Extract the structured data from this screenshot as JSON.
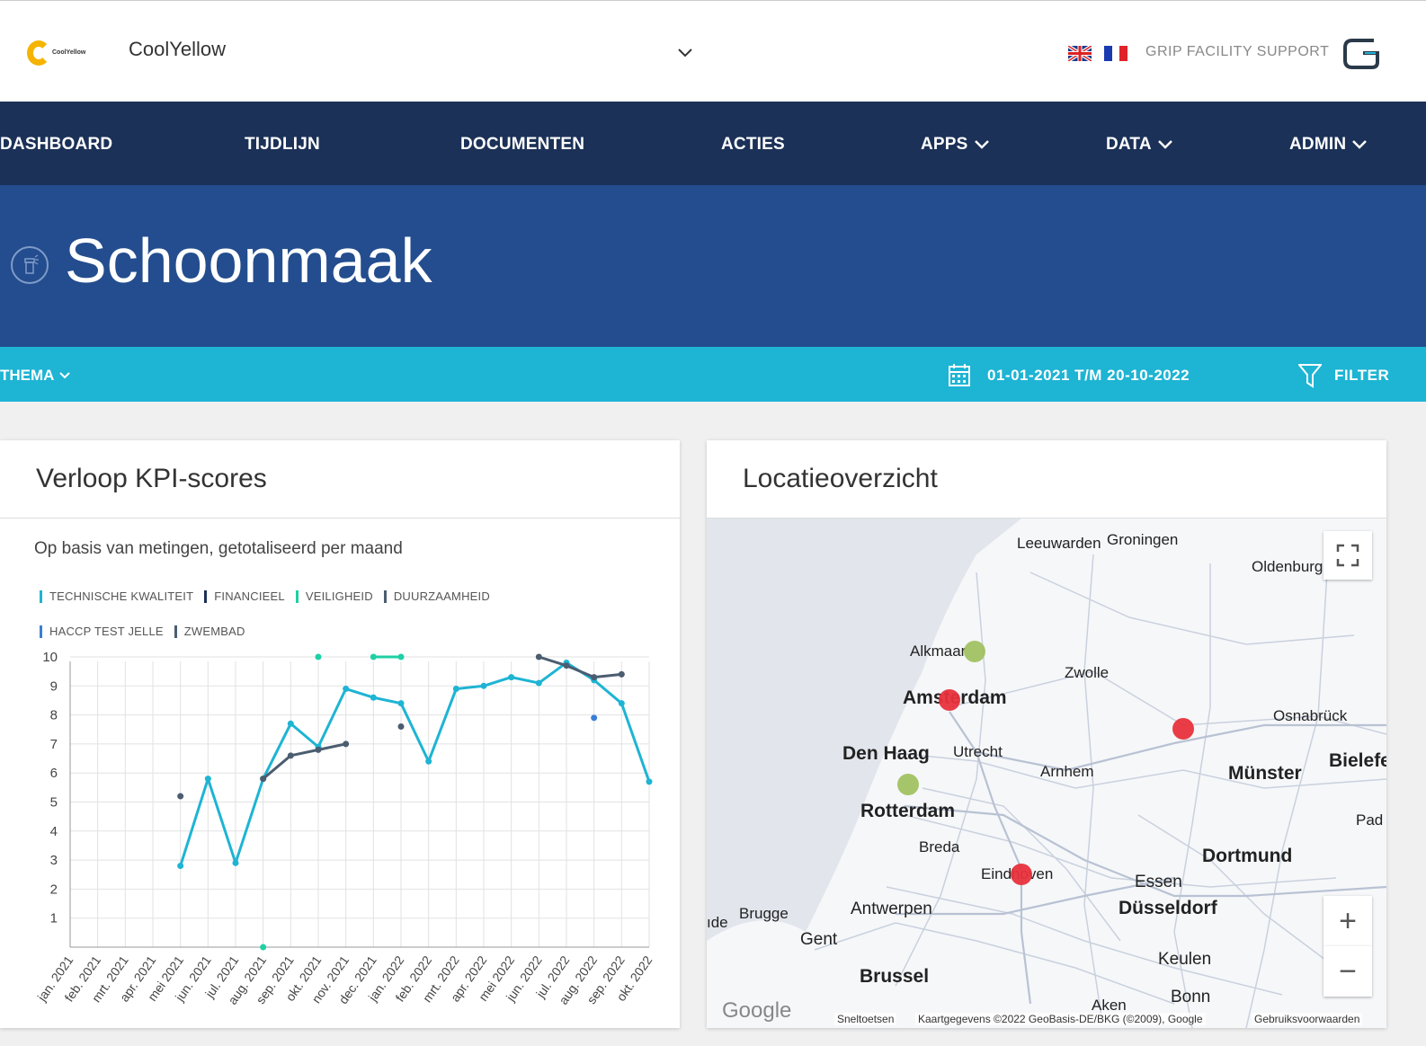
{
  "header": {
    "client_name": "CoolYellow",
    "logo_text": "CoolYellow",
    "support_label": "GRIP FACILITY SUPPORT",
    "flags": [
      "UK flag",
      "French flag"
    ]
  },
  "nav": {
    "items": [
      {
        "label": "DASHBOARD",
        "dropdown": false
      },
      {
        "label": "TIJDLIJN",
        "dropdown": false
      },
      {
        "label": "DOCUMENTEN",
        "dropdown": false
      },
      {
        "label": "ACTIES",
        "dropdown": false
      },
      {
        "label": "APPS",
        "dropdown": true
      },
      {
        "label": "DATA",
        "dropdown": true
      },
      {
        "label": "ADMIN",
        "dropdown": true
      }
    ]
  },
  "hero": {
    "title": "Schoonmaak",
    "icon": "cleaning-spray-icon"
  },
  "filterbar": {
    "thema_label": "THEMA",
    "date_range": "01-01-2021 T/M 20-10-2022",
    "filter_label": "FILTER"
  },
  "kpi_card": {
    "title": "Verloop KPI-scores",
    "subtitle": "Op basis van metingen, getotaliseerd per maand"
  },
  "map_card": {
    "title": "Locatieoverzicht",
    "cities": [
      {
        "name": "Leeuwarden"
      },
      {
        "name": "Groningen"
      },
      {
        "name": "Oldenburg"
      },
      {
        "name": "Alkmaar"
      },
      {
        "name": "Zwolle"
      },
      {
        "name": "Amsterdam"
      },
      {
        "name": "Osnabrück"
      },
      {
        "name": "Den Haag"
      },
      {
        "name": "Utrecht"
      },
      {
        "name": "Bielefe"
      },
      {
        "name": "Arnhem"
      },
      {
        "name": "Münster"
      },
      {
        "name": "Rotterdam"
      },
      {
        "name": "Pad"
      },
      {
        "name": "Breda"
      },
      {
        "name": "Dortmund"
      },
      {
        "name": "Eindhoven"
      },
      {
        "name": "Essen"
      },
      {
        "name": "Brugge"
      },
      {
        "name": "Antwerpen"
      },
      {
        "name": "Düsseldorf"
      },
      {
        "name": "Gent"
      },
      {
        "name": "Keulen"
      },
      {
        "name": "Brussel"
      },
      {
        "name": "Bonn"
      },
      {
        "name": "Aken"
      },
      {
        "name": "Br"
      },
      {
        "name": "ıde"
      }
    ],
    "markers": [
      {
        "color": "#9dbf5a",
        "status": "green"
      },
      {
        "color": "#e8323c",
        "status": "red"
      },
      {
        "color": "#e8323c",
        "status": "red"
      },
      {
        "color": "#9dbf5a",
        "status": "green"
      },
      {
        "color": "#e8323c",
        "status": "red"
      }
    ],
    "footer": {
      "google": "Google",
      "shortcuts": "Sneltoetsen",
      "mapdata": "Kaartgegevens ©2022 GeoBasis-DE/BKG (©2009), Google",
      "terms": "Gebruiksvoorwaarden"
    },
    "zoom_in": "+",
    "zoom_out": "−"
  },
  "colors": {
    "nav_bg": "#1b3157",
    "hero_bg": "#234d8e",
    "filter_bg": "#1eb4d4",
    "series_teal": "#1eb4d4",
    "series_green": "#1fd0a4",
    "series_dark": "#4b5d70",
    "marker_red": "#e8323c",
    "marker_green": "#9dbf5a"
  },
  "chart_data": {
    "type": "line",
    "title": "Verloop KPI-scores",
    "subtitle": "Op basis van metingen, getotaliseerd per maand",
    "categories": [
      "jan. 2021",
      "feb. 2021",
      "mrt. 2021",
      "apr. 2021",
      "mei 2021",
      "jun. 2021",
      "jul. 2021",
      "aug. 2021",
      "sep. 2021",
      "okt. 2021",
      "nov. 2021",
      "dec. 2021",
      "jan. 2022",
      "feb. 2022",
      "mrt. 2022",
      "apr. 2022",
      "mei 2022",
      "jun. 2022",
      "jul. 2022",
      "aug. 2022",
      "sep. 2022",
      "okt. 2022"
    ],
    "ylim": [
      0,
      10
    ],
    "yticks": [
      1,
      2,
      3,
      4,
      5,
      6,
      7,
      8,
      9,
      10
    ],
    "grid": true,
    "legend_position": "top-left",
    "legend": [
      {
        "name": "TECHNISCHE KWALITEIT",
        "color": "#1eb4d4"
      },
      {
        "name": "FINANCIEEL",
        "color": "#1b3157"
      },
      {
        "name": "VEILIGHEID",
        "color": "#1fd0a4"
      },
      {
        "name": "DUURZAAMHEID",
        "color": "#4b5d70"
      },
      {
        "name": "HACCP TEST JELLE",
        "color": "#3a7fd5"
      },
      {
        "name": "ZWEMBAD",
        "color": "#4b5d70"
      }
    ],
    "series": [
      {
        "name": "TECHNISCHE KWALITEIT",
        "color": "#1eb4d4",
        "values": [
          null,
          null,
          null,
          null,
          2.8,
          5.8,
          2.9,
          5.8,
          7.7,
          6.9,
          8.9,
          8.6,
          8.4,
          6.4,
          8.9,
          9.0,
          9.3,
          9.1,
          9.8,
          9.2,
          8.4,
          5.7
        ]
      },
      {
        "name": "VEILIGHEID",
        "color": "#1fd0a4",
        "values": [
          null,
          null,
          null,
          null,
          null,
          null,
          null,
          0,
          null,
          10,
          null,
          10,
          10,
          null,
          null,
          null,
          null,
          null,
          null,
          null,
          null,
          null
        ]
      },
      {
        "name": "DUURZAAMHEID",
        "color": "#4b5d70",
        "values": [
          null,
          null,
          null,
          null,
          5.2,
          null,
          null,
          5.8,
          6.6,
          6.8,
          7.0,
          null,
          7.6,
          null,
          null,
          null,
          null,
          null,
          null,
          null,
          null,
          null
        ]
      },
      {
        "name": "ZWEMBAD",
        "color": "#4b5d70",
        "values": [
          null,
          null,
          null,
          null,
          null,
          null,
          null,
          null,
          null,
          null,
          null,
          null,
          null,
          null,
          null,
          null,
          null,
          10,
          9.7,
          9.3,
          9.4,
          null
        ]
      },
      {
        "name": "HACCP TEST JELLE",
        "color": "#3a7fd5",
        "values": [
          null,
          null,
          null,
          null,
          null,
          null,
          null,
          null,
          null,
          null,
          null,
          null,
          null,
          null,
          null,
          null,
          null,
          null,
          null,
          7.9,
          null,
          null
        ]
      }
    ]
  }
}
